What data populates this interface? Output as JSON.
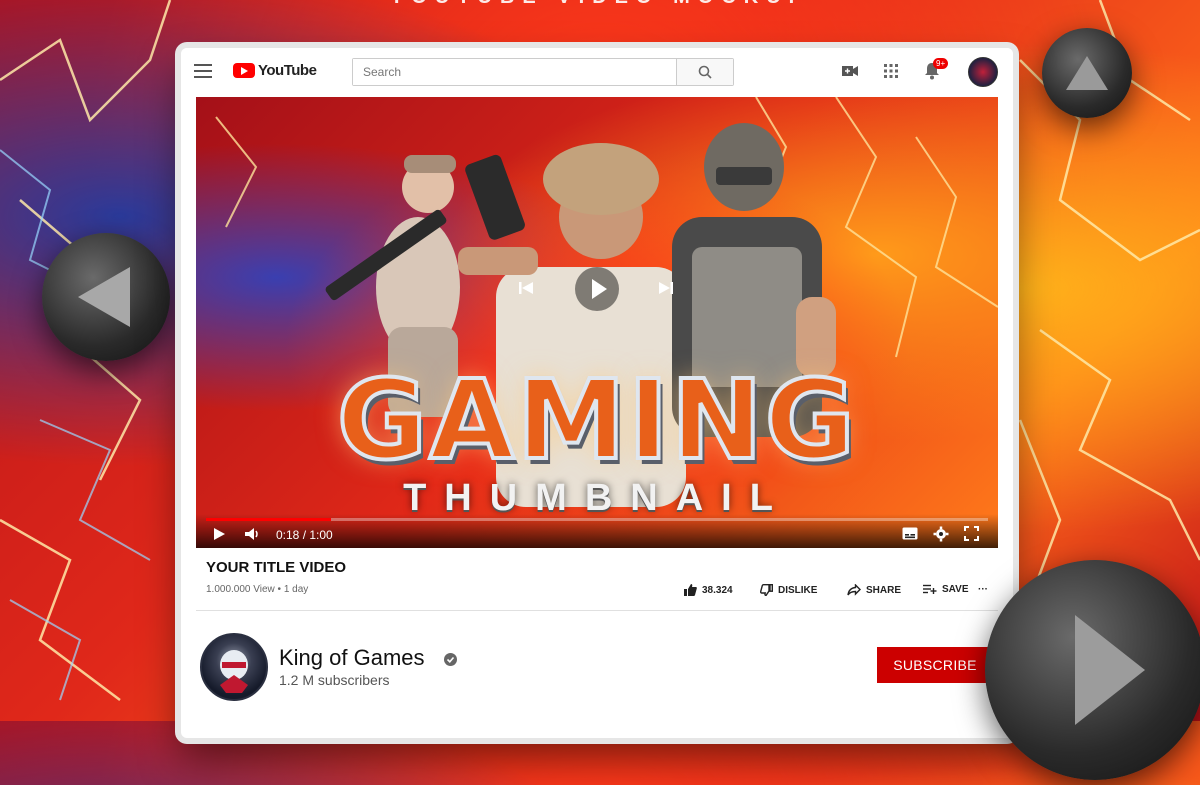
{
  "page": {
    "caption": "YOUTUBE VIDEO MOCKUP"
  },
  "header": {
    "logo_text": "YouTube",
    "search": {
      "placeholder": "Search",
      "value": ""
    },
    "notification_count": "9+",
    "icons": [
      "menu-icon",
      "search-icon",
      "video-camera-icon",
      "apps-grid-icon",
      "bell-icon",
      "avatar"
    ]
  },
  "player": {
    "thumbnail_title": "GAMING",
    "thumbnail_subtitle": "THUMBNAIL",
    "time": "0:18 / 1:00",
    "progress": 0.16
  },
  "video": {
    "title": "YOUR TITLE VIDEO",
    "meta": "1.000.000 View • 1 day",
    "likes": "38.324",
    "dislike_label": "DISLIKE",
    "share_label": "SHARE",
    "save_label": "SAVE",
    "more_label": "···"
  },
  "channel": {
    "name": "King of Games",
    "subscribers": "1.2 M subscribers",
    "subscribe_label": "SUBSCRIBE"
  },
  "colors": {
    "brand_red": "#ff0000",
    "subscribe_red": "#cc0000",
    "progress_red": "#ff0000"
  }
}
